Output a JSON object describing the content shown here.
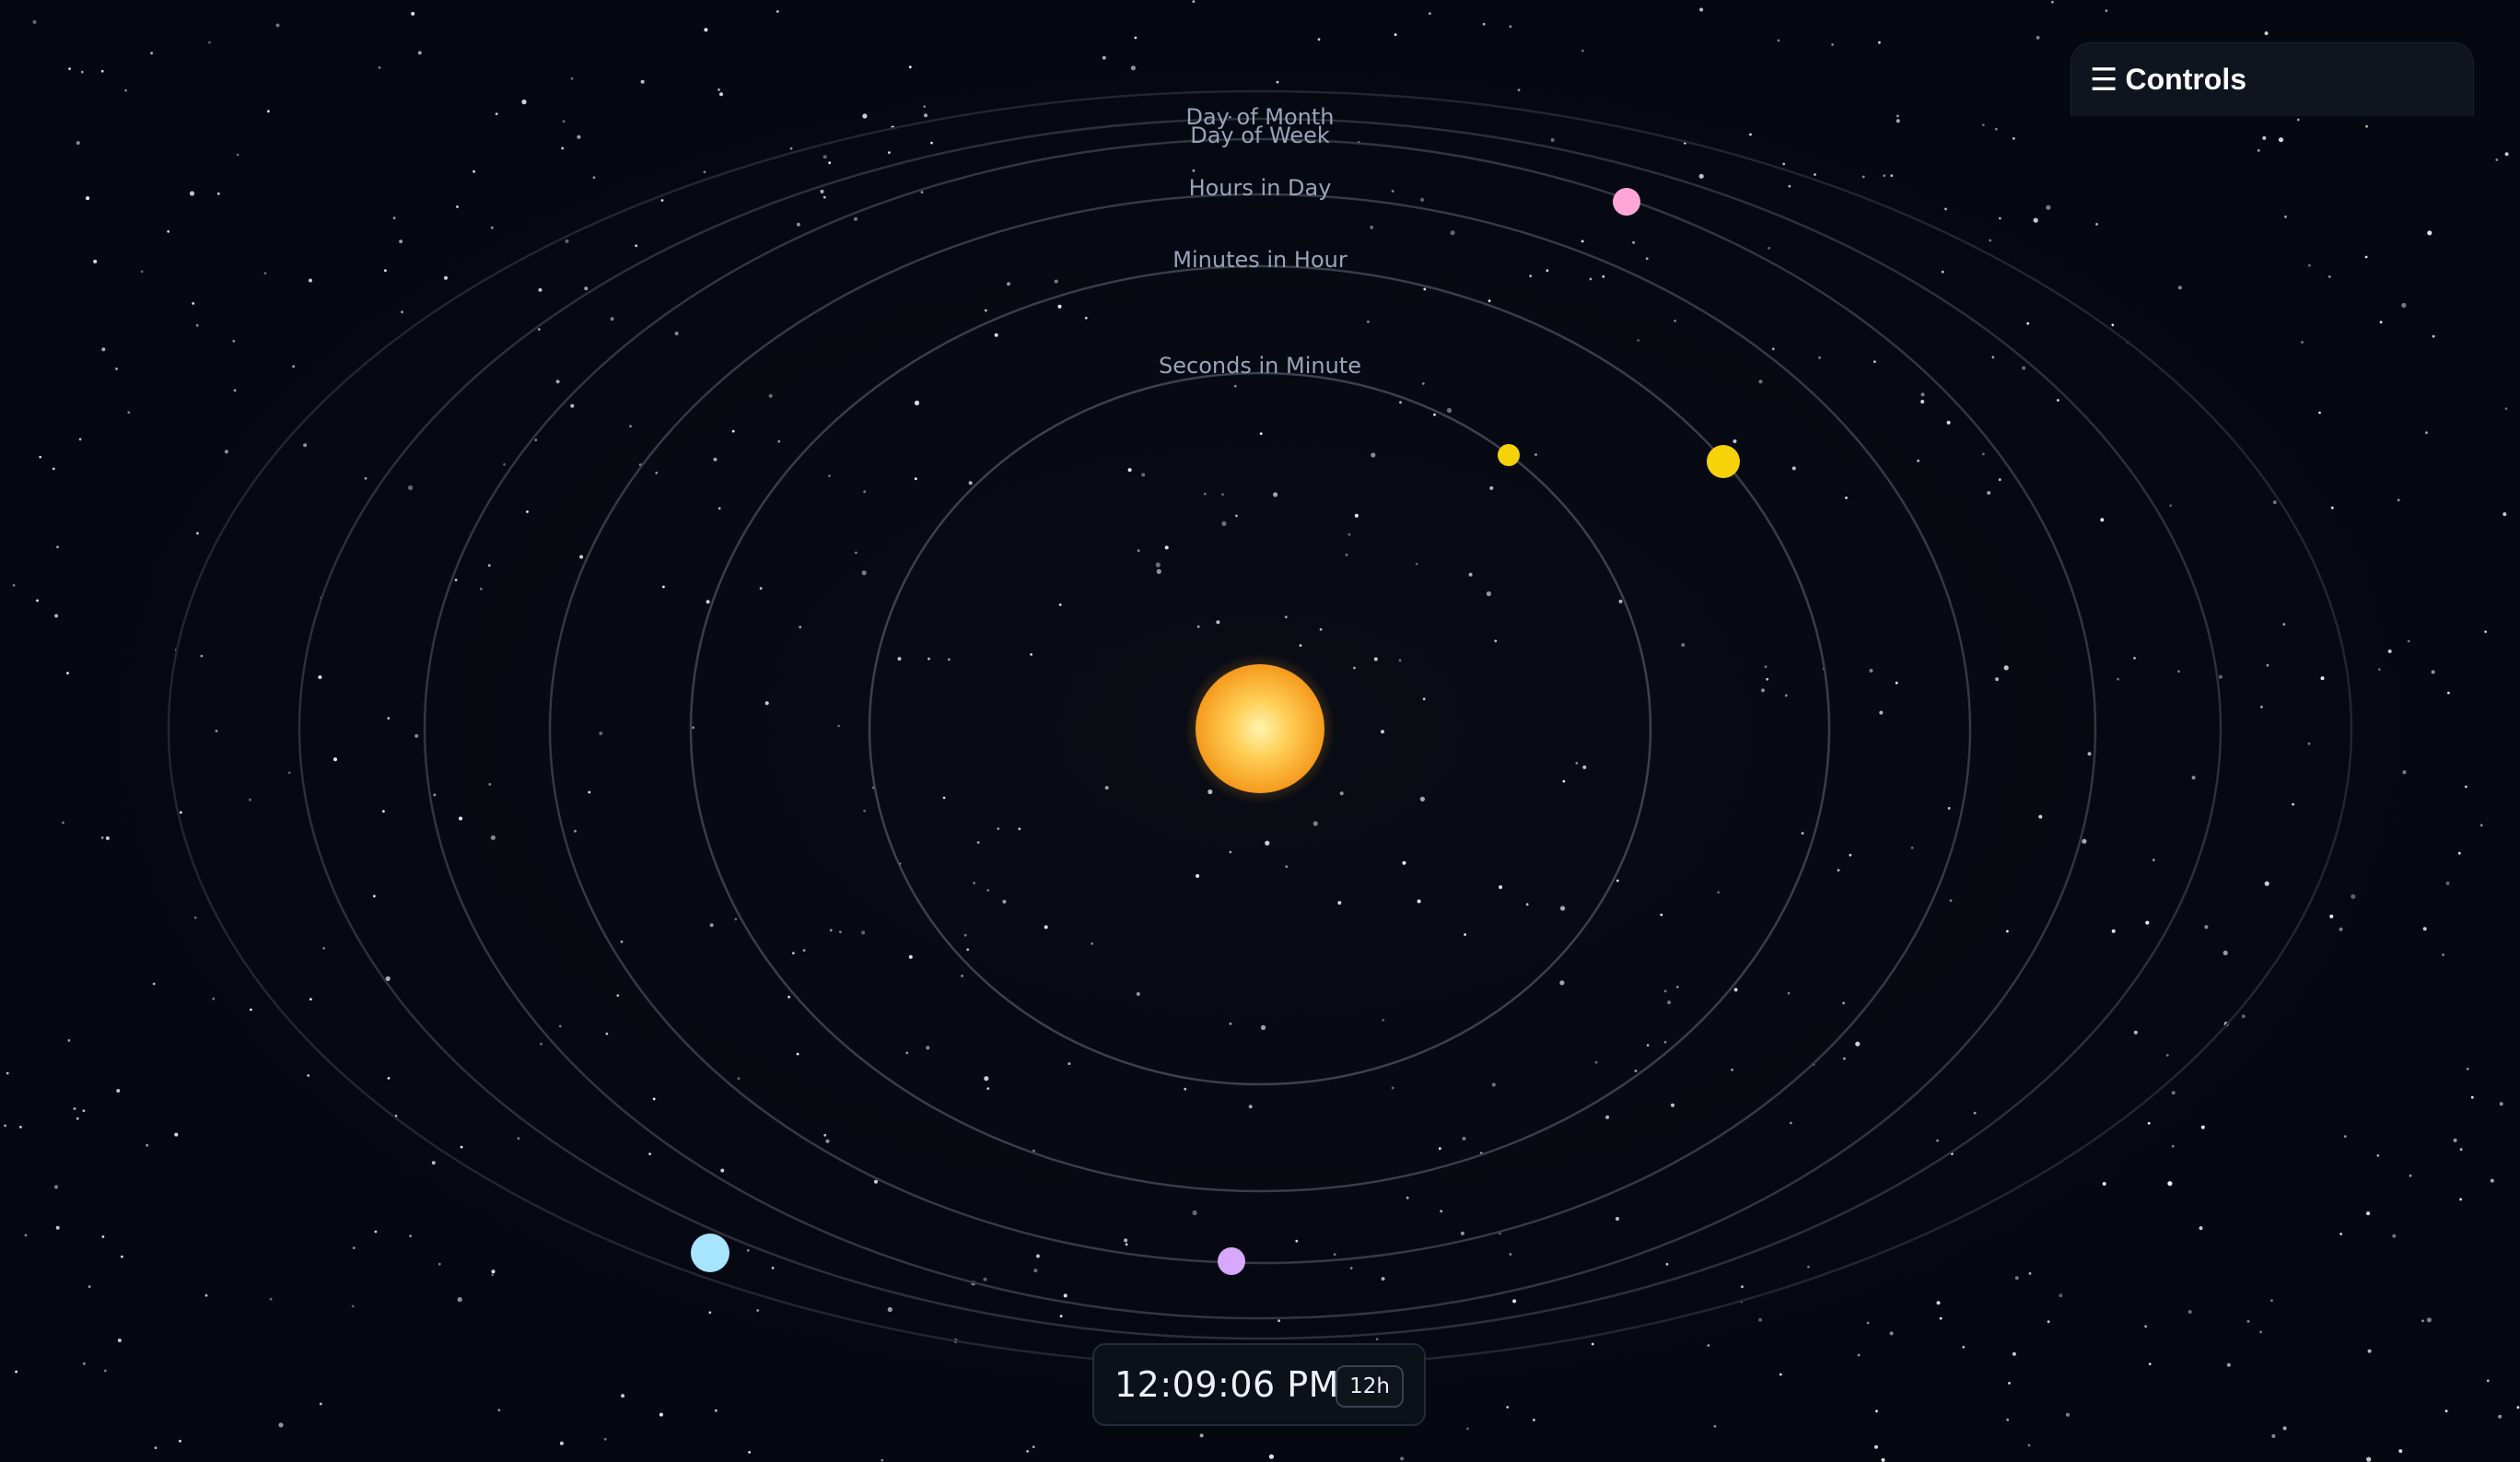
{
  "orbits": [
    {
      "label": "Seconds in Minute"
    },
    {
      "label": "Minutes in Hour"
    },
    {
      "label": "Hours in Day"
    },
    {
      "label": "Day of Week"
    },
    {
      "label": "Day of Month"
    },
    {
      "label": ""
    }
  ],
  "planets": [
    {
      "name": "seconds-planet",
      "color": "#f5d20a"
    },
    {
      "name": "minutes-planet",
      "color": "#f5d20a"
    },
    {
      "name": "hours-planet",
      "color": "#d8a8ff"
    },
    {
      "name": "day-of-week-planet",
      "color": "#ffa6d8"
    },
    {
      "name": "day-of-month-planet",
      "color": "#a6e4ff"
    }
  ],
  "sun": {
    "color": "#ffc23d"
  },
  "controls": {
    "icon": "menu-icon",
    "icon_glyph": "☰",
    "title": "Controls"
  },
  "clock": {
    "time": "12:09:06 PM",
    "format_label": "12h"
  },
  "colors": {
    "background": "#060811",
    "orbit": "#3a3e4a",
    "label": "#9aa3b8"
  }
}
